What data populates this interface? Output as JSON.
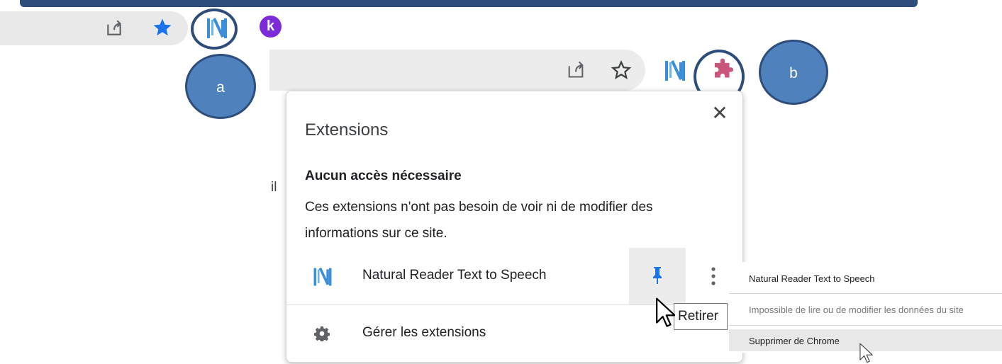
{
  "callouts": {
    "a": "a",
    "b": "b"
  },
  "toolbar_top": {
    "k_label": "k"
  },
  "popup": {
    "title": "Extensions",
    "close_glyph": "✕",
    "subheading": "Aucun accès nécessaire",
    "description": "Ces extensions n'ont pas besoin de voir ni de modifier des informations sur ce site.",
    "extension_name": "Natural Reader Text to Speech",
    "manage_label": "Gérer les extensions"
  },
  "tooltip": "Retirer",
  "context_menu": {
    "items": [
      "Natural Reader Text to Speech",
      "Impossible de lire ou de modifier les données du site",
      "Supprimer de Chrome"
    ]
  },
  "background_fragment": "il",
  "icons": {
    "share": "share-icon",
    "star": "star-icon",
    "natural_reader": "natural-reader-icon",
    "puzzle": "puzzle-extensions-icon",
    "pin": "pin-icon",
    "kebab": "more-vert-icon",
    "gear": "gear-icon",
    "cursor": "mouse-cursor-icon"
  },
  "colors": {
    "callout_fill": "#4f81bd",
    "callout_border": "#2e4d7b",
    "star_active": "#1a73e8",
    "natural_reader_blue": "#3b8fd8",
    "puzzle_pink": "#c9567a",
    "k_purple": "#7b2bd8"
  }
}
